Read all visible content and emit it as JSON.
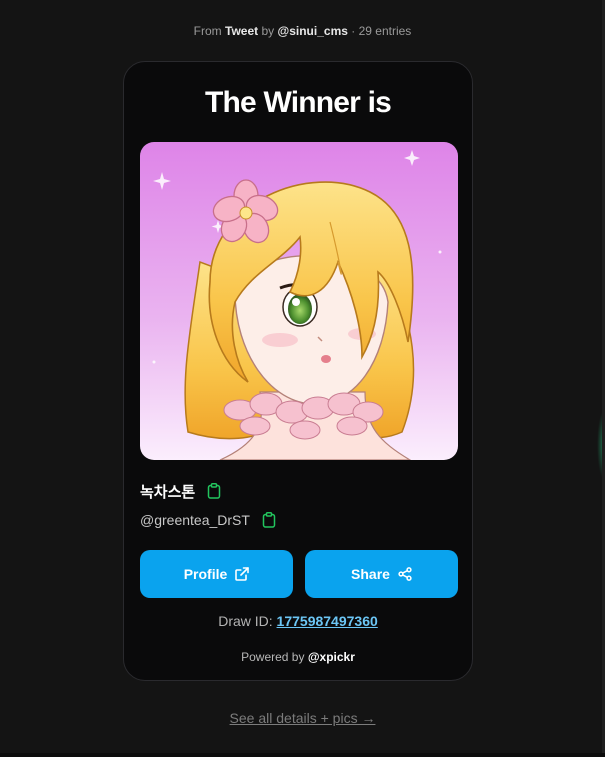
{
  "source": {
    "prefix": "From",
    "platform": "Tweet",
    "by_word": "by",
    "author": "@sinui_cms",
    "separator": "·",
    "entries": "29 entries"
  },
  "card": {
    "title": "The Winner is",
    "winner": {
      "display_name": "녹차스톤",
      "handle": "@greentea_DrST"
    },
    "buttons": {
      "profile_label": "Profile",
      "share_label": "Share"
    },
    "draw": {
      "label": "Draw ID:",
      "id": "1775987497360"
    },
    "powered": {
      "label": "Powered by",
      "brand": "@xpickr"
    }
  },
  "footer": {
    "details_link": "See all details + pics →"
  },
  "icons": {
    "copy": "clipboard-icon",
    "profile": "external-link-icon",
    "share": "share-icon"
  },
  "colors": {
    "background": "#141414",
    "card": "#0a0a0b",
    "button": "#0aa3ee",
    "copy_icon": "#22c55e",
    "link": "#6cc6f5"
  }
}
